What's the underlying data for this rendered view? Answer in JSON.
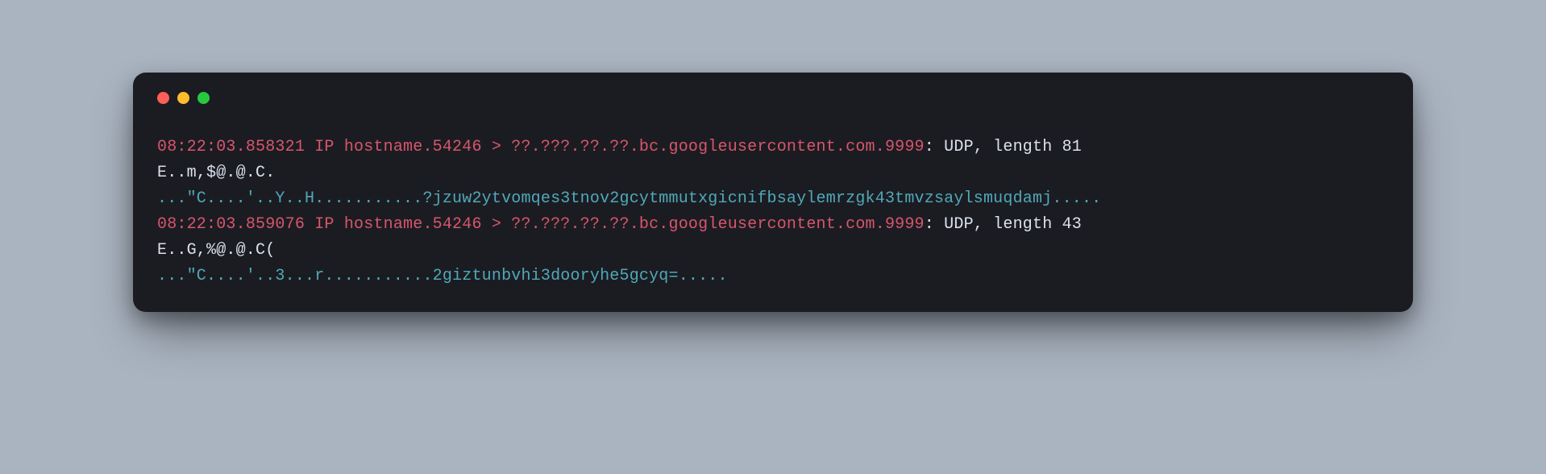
{
  "terminal": {
    "lines": [
      {
        "segments": [
          {
            "cls": "red-txt",
            "text": "08:22:03.858321 IP hostname.54246 > ??.???.??.??.bc.googleusercontent.com.9999"
          },
          {
            "cls": "plain-txt",
            "text": ": UDP, length 81"
          }
        ]
      },
      {
        "segments": [
          {
            "cls": "plain-txt",
            "text": "E..m,$@.@.C."
          }
        ]
      },
      {
        "segments": [
          {
            "cls": "teal-txt",
            "text": "...\"C....'..Y..H...........?jzuw2ytvomqes3tnov2gcytmmutxgicnifbsaylemrzgk43tmvzsaylsmuqdamj....."
          }
        ]
      },
      {
        "segments": [
          {
            "cls": "red-txt",
            "text": "08:22:03.859076 IP hostname.54246 > ??.???.??.??.bc.googleusercontent.com.9999"
          },
          {
            "cls": "plain-txt",
            "text": ": UDP, length 43"
          }
        ]
      },
      {
        "segments": [
          {
            "cls": "plain-txt",
            "text": "E..G,%@.@.C("
          }
        ]
      },
      {
        "segments": [
          {
            "cls": "teal-txt",
            "text": "...\"C....'..3...r...........2giztunbvhi3dooryhe5gcyq=....."
          }
        ]
      }
    ]
  }
}
